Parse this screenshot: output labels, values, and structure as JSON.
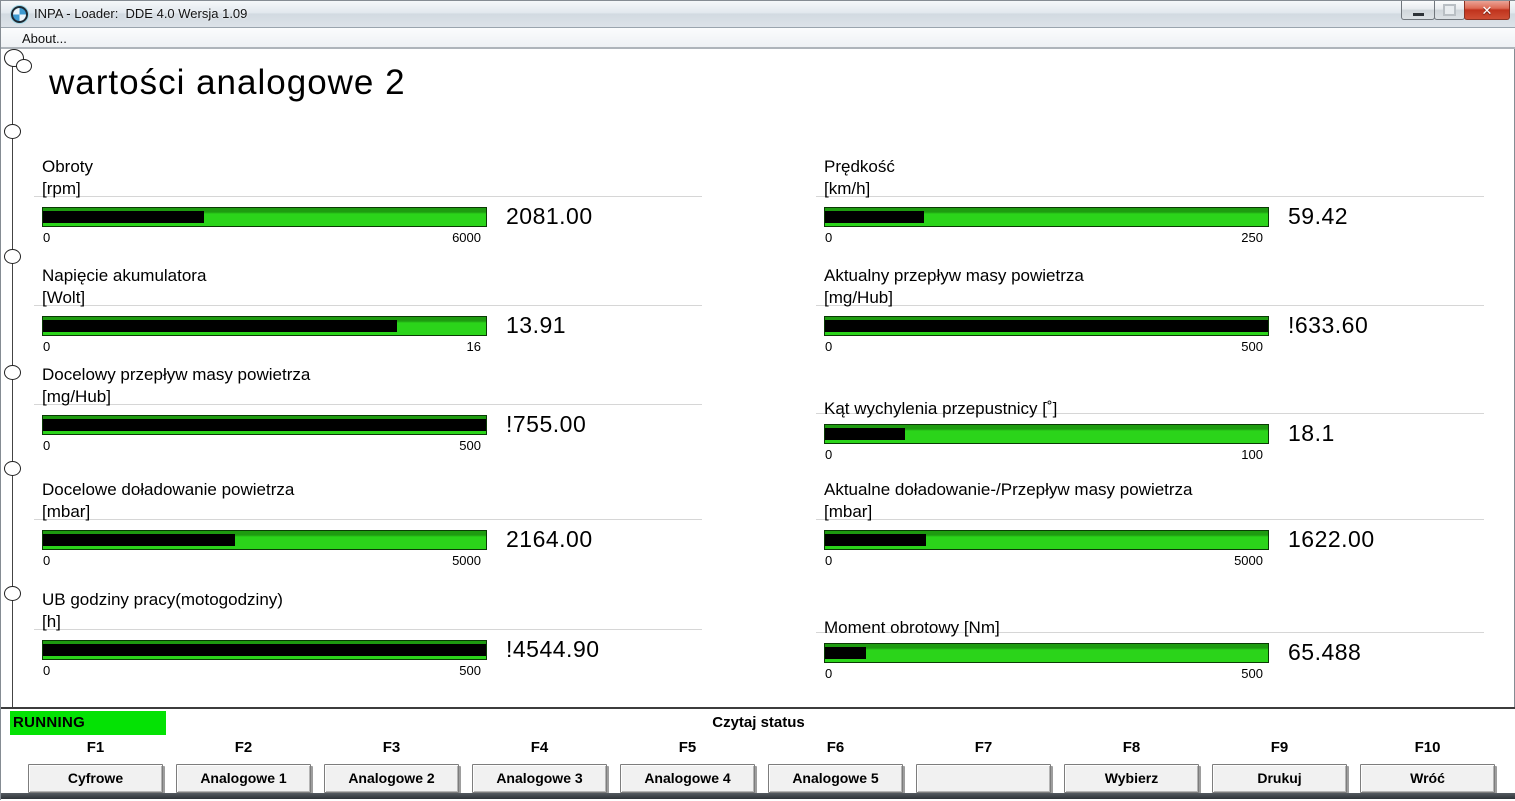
{
  "window": {
    "title": "INPA - Loader:  DDE 4.0 Wersja 1.09",
    "menu": {
      "about": "About..."
    },
    "controls": {
      "minimize_icon": "minimize-bar-shape",
      "maximize_icon": "square-shape",
      "close_glyph": "✕"
    },
    "app_icon": "bmw-roundel"
  },
  "page": {
    "title": "wartości analogowe 2"
  },
  "gauges": [
    {
      "label": "Obroty",
      "unit": "[rpm]",
      "min": "0",
      "max": "6000",
      "value": "2081.00",
      "fill_style": "width:36.3%"
    },
    {
      "label": "Napięcie akumulatora",
      "unit": "[Wolt]",
      "min": "0",
      "max": "16",
      "value": "13.91",
      "fill_style": "width:80%"
    },
    {
      "label": "Docelowy przepływ masy powietrza",
      "unit": "[mg/Hub]",
      "min": "0",
      "max": "500",
      "value": "!755.00",
      "fill_style": "width:100%"
    },
    {
      "label": "Docelowe doładowanie powietrza",
      "unit": "[mbar]",
      "min": "0",
      "max": "5000",
      "value": "2164.00",
      "fill_style": "width:43.3%"
    },
    {
      "label": "UB godziny pracy(motogodziny)",
      "unit": "[h]",
      "min": "0",
      "max": "500",
      "value": "!4544.90",
      "fill_style": "width:100%"
    },
    {
      "label": "Prędkość",
      "unit": "[km/h]",
      "min": "0",
      "max": "250",
      "value": "59.42",
      "fill_style": "width:22.3%"
    },
    {
      "label": "Aktualny przepływ masy powietrza",
      "unit": "[mg/Hub]",
      "min": "0",
      "max": "500",
      "value": "!633.60",
      "fill_style": "width:100%"
    },
    {
      "label": "Kąt wychylenia przepustnicy [˚]",
      "unit": "",
      "min": "0",
      "max": "100",
      "value": "18.1",
      "fill_style": "width:18.1%"
    },
    {
      "label": "Aktualne doładowanie-/Przepływ masy powietrza",
      "unit": "[mbar]",
      "min": "0",
      "max": "5000",
      "value": "1622.00",
      "fill_style": "width:22.8%"
    },
    {
      "label": "Moment obrotowy [Nm]",
      "unit": "",
      "min": "0",
      "max": "500",
      "value": "65.488",
      "fill_style": "width:9.3%"
    }
  ],
  "footer": {
    "status": "RUNNING",
    "center_status": "Czytaj status",
    "fkeys": [
      {
        "key": "F1",
        "label": "Cyfrowe"
      },
      {
        "key": "F2",
        "label": "Analogowe 1"
      },
      {
        "key": "F3",
        "label": "Analogowe 2"
      },
      {
        "key": "F4",
        "label": "Analogowe 3"
      },
      {
        "key": "F5",
        "label": "Analogowe 4"
      },
      {
        "key": "F6",
        "label": "Analogowe 5"
      },
      {
        "key": "F7",
        "label": ""
      },
      {
        "key": "F8",
        "label": "Wybierz"
      },
      {
        "key": "F9",
        "label": "Drukuj"
      },
      {
        "key": "F10",
        "label": "Wróć"
      }
    ]
  },
  "colors": {
    "bar_green": "#2bd41a",
    "status_green": "#04e204",
    "close_red": "#c0331d"
  }
}
